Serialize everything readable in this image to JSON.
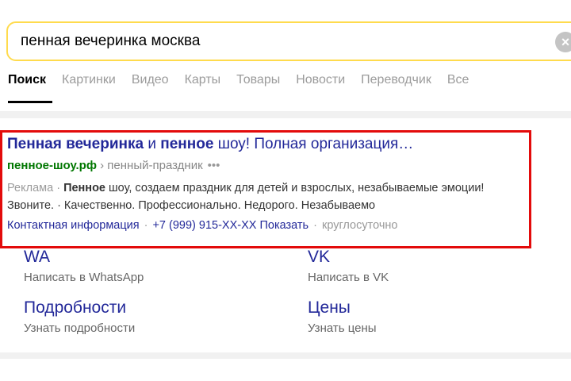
{
  "search": {
    "query": "пенная вечеринка москва",
    "clear_icon": "×"
  },
  "tabs": [
    "Поиск",
    "Картинки",
    "Видео",
    "Карты",
    "Товары",
    "Новости",
    "Переводчик",
    "Все"
  ],
  "ad": {
    "title_bold1": "Пенная вечеринка",
    "title_mid": " и ",
    "title_bold2": "пенное",
    "title_rest": " шоу! Полная организация…",
    "domain": "пенное-шоу.рф",
    "path": " › пенный-праздник",
    "dots": "•••",
    "label": "Реклама",
    "label_sep": " · ",
    "text_bold": "Пенное",
    "text_rest": " шоу, создаем праздник для детей и взрослых, незабываемые эмоции! Звоните. · Качественно. Профессионально. Недорого. Незабываемо",
    "link_contact": "Контактная информация",
    "link_phone": "+7 (999) 915-XX-XX Показать",
    "link_hours": "круглосуточно",
    "sep": "·"
  },
  "sitelinks": [
    {
      "title": "WA",
      "sub": "Написать в WhatsApp"
    },
    {
      "title": "VK",
      "sub": "Написать в VK"
    },
    {
      "title": "Подробности",
      "sub": "Узнать подробности"
    },
    {
      "title": "Цены",
      "sub": "Узнать цены"
    }
  ],
  "colors": {
    "accent": "#ffdb4d",
    "link": "#222899",
    "url": "#007700",
    "highlight_frame": "#e30b0b"
  }
}
